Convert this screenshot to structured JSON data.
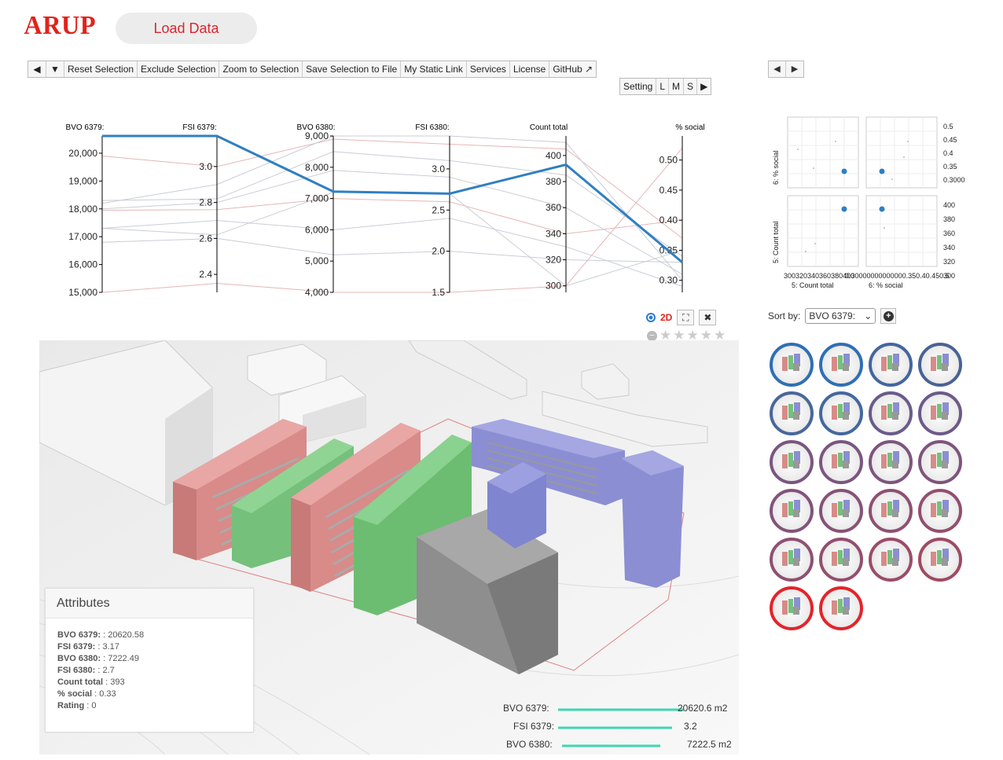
{
  "brand": {
    "logo": "ARUP"
  },
  "header": {
    "load_label": "Load Data"
  },
  "toolbar": {
    "left_icon": "◀",
    "down_icon": "▼",
    "buttons": [
      "Reset Selection",
      "Exclude Selection",
      "Zoom to Selection",
      "Save Selection to File",
      "My Static Link",
      "Services",
      "License",
      "GitHub"
    ],
    "external_icon": "↗"
  },
  "size_bar": {
    "setting": "Setting",
    "l": "L",
    "m": "M",
    "s": "S",
    "next": "▶"
  },
  "right_nav": {
    "prev": "◀",
    "next": "▶"
  },
  "chart_data": [
    {
      "type": "parallel-coordinates",
      "axes": [
        {
          "name": "BVO 6379:",
          "ticks": [
            "20,000",
            "19,000",
            "18,000",
            "17,000",
            "16,000",
            "15,000"
          ],
          "range": [
            15000,
            20620
          ]
        },
        {
          "name": "FSI 6379:",
          "ticks": [
            "3.0",
            "2.8",
            "2.6",
            "2.4"
          ],
          "range": [
            2.3,
            3.17
          ]
        },
        {
          "name": "BVO 6380:",
          "ticks": [
            "9,000",
            "8,000",
            "7,000",
            "6,000",
            "5,000",
            "4,000"
          ],
          "range": [
            4000,
            9000
          ]
        },
        {
          "name": "FSI 6380:",
          "ticks": [
            "3.0",
            "2.5",
            "2.0",
            "1.5"
          ],
          "range": [
            1.5,
            3.4
          ]
        },
        {
          "name": "Count total",
          "ticks": [
            "400",
            "380",
            "360",
            "340",
            "320",
            "300"
          ],
          "range": [
            295,
            415
          ]
        },
        {
          "name": "% social",
          "ticks": [
            "0.50",
            "0.45",
            "0.40",
            "0.35",
            "0.30"
          ],
          "range": [
            0.28,
            0.54
          ]
        }
      ],
      "highlighted": {
        "values": [
          20620.58,
          3.17,
          7222.49,
          2.7,
          393,
          0.33
        ],
        "color": "#2f7fc1"
      }
    },
    {
      "type": "scatter-matrix",
      "row_labels": [
        "6: % social",
        "5: Count total"
      ],
      "col_labels": [
        "5: Count total",
        "6: % social"
      ],
      "y_ticks_top": [
        "0.5",
        "0.45",
        "0.4",
        "0.35",
        "0.3000"
      ],
      "y_ticks_bottom": [
        "400",
        "380",
        "360",
        "340",
        "320",
        "300"
      ],
      "x_ticks_left": "300320340360380400",
      "x_ticks_right": "0.30000000000000.350.40.450.5",
      "selected_point": {
        "count_total": 393,
        "social": 0.33
      }
    }
  ],
  "view": {
    "mode_2d": "2D",
    "expand_icon": "⛶",
    "close_icon": "✖",
    "rating_stars": 5,
    "rating": 0
  },
  "attributes": {
    "title": "Attributes",
    "rows": [
      {
        "k": "BVO 6379:",
        "v": ": 20620.58"
      },
      {
        "k": "FSI 6379:",
        "v": ": 3.17"
      },
      {
        "k": "BVO 6380:",
        "v": ": 7222.49"
      },
      {
        "k": "FSI 6380:",
        "v": ": 2.7"
      },
      {
        "k": "Count total",
        "v": ": 393"
      },
      {
        "k": "% social",
        "v": ": 0.33"
      },
      {
        "k": "Rating",
        "v": ": 0"
      }
    ]
  },
  "overlay_metrics": [
    {
      "label": "BVO 6379:",
      "value": "20620.6 m2",
      "fill": 0.82
    },
    {
      "label": "FSI 6379:",
      "value": "3.2",
      "fill": 0.7
    },
    {
      "label": "BVO 6380:",
      "value": "7222.5 m2",
      "fill": 0.6
    }
  ],
  "sort": {
    "label": "Sort by:",
    "selected": "BVO 6379:",
    "add_icon": "+"
  },
  "thumbnails": {
    "ring_colors": [
      "#2f6fb5",
      "#2f6fb5",
      "#43669f",
      "#496393",
      "#48679b",
      "#43689f",
      "#6a5b8b",
      "#6c5a8a",
      "#7a567f",
      "#7b5680",
      "#7d557e",
      "#7f547c",
      "#83537a",
      "#875277",
      "#8e5072",
      "#934e6e",
      "#8f5071",
      "#944e6d",
      "#9b4c68",
      "#a04a64",
      "#e3242b",
      "#e3242b"
    ]
  }
}
